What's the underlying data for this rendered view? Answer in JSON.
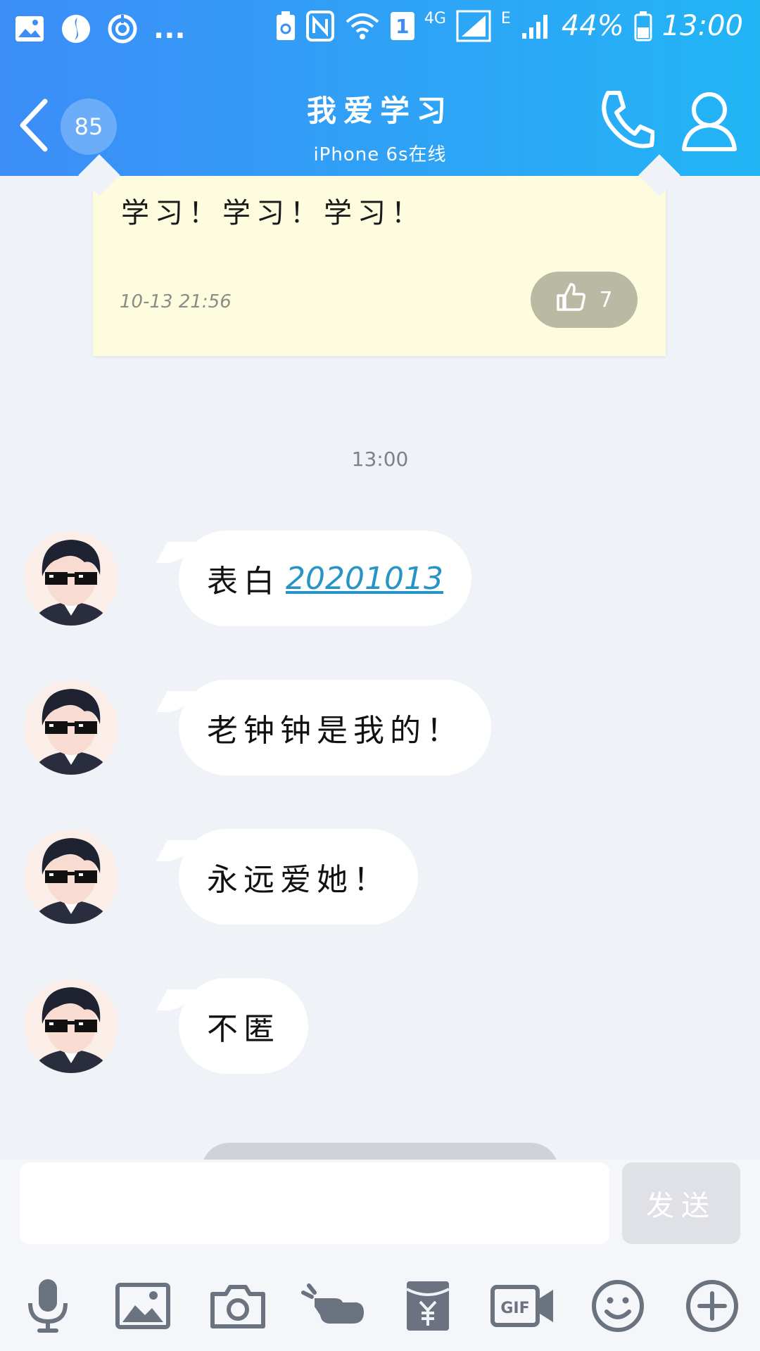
{
  "status_bar": {
    "more": "...",
    "network_4g": "4G",
    "network_e": "E",
    "sim_slot": "1",
    "battery": "44%",
    "time": "13:00"
  },
  "header": {
    "unread_count": "85",
    "title": "我爱学习",
    "subtitle": "iPhone 6s在线"
  },
  "note": {
    "text": "学习！学习！学习！",
    "time": "10-13 21:56",
    "likes": "7"
  },
  "timestamp": "13:00",
  "messages": [
    {
      "prefix": "表白",
      "link": "20201013"
    },
    {
      "text": "老钟钟是我的！"
    },
    {
      "text": "永远爱她！"
    },
    {
      "text": "不匿"
    }
  ],
  "input": {
    "value": "",
    "send_label": "发送"
  },
  "toolbar": [
    "microphone-icon",
    "image-icon",
    "camera-icon",
    "poke-icon",
    "red-packet-icon",
    "gif-icon",
    "emoji-icon",
    "plus-icon"
  ],
  "colors": {
    "header_start": "#3d8df7",
    "header_end": "#22b5f6",
    "background": "#eff2f7",
    "note": "#fefcde",
    "link": "#2794c8",
    "icon_gray": "#6b7380"
  }
}
